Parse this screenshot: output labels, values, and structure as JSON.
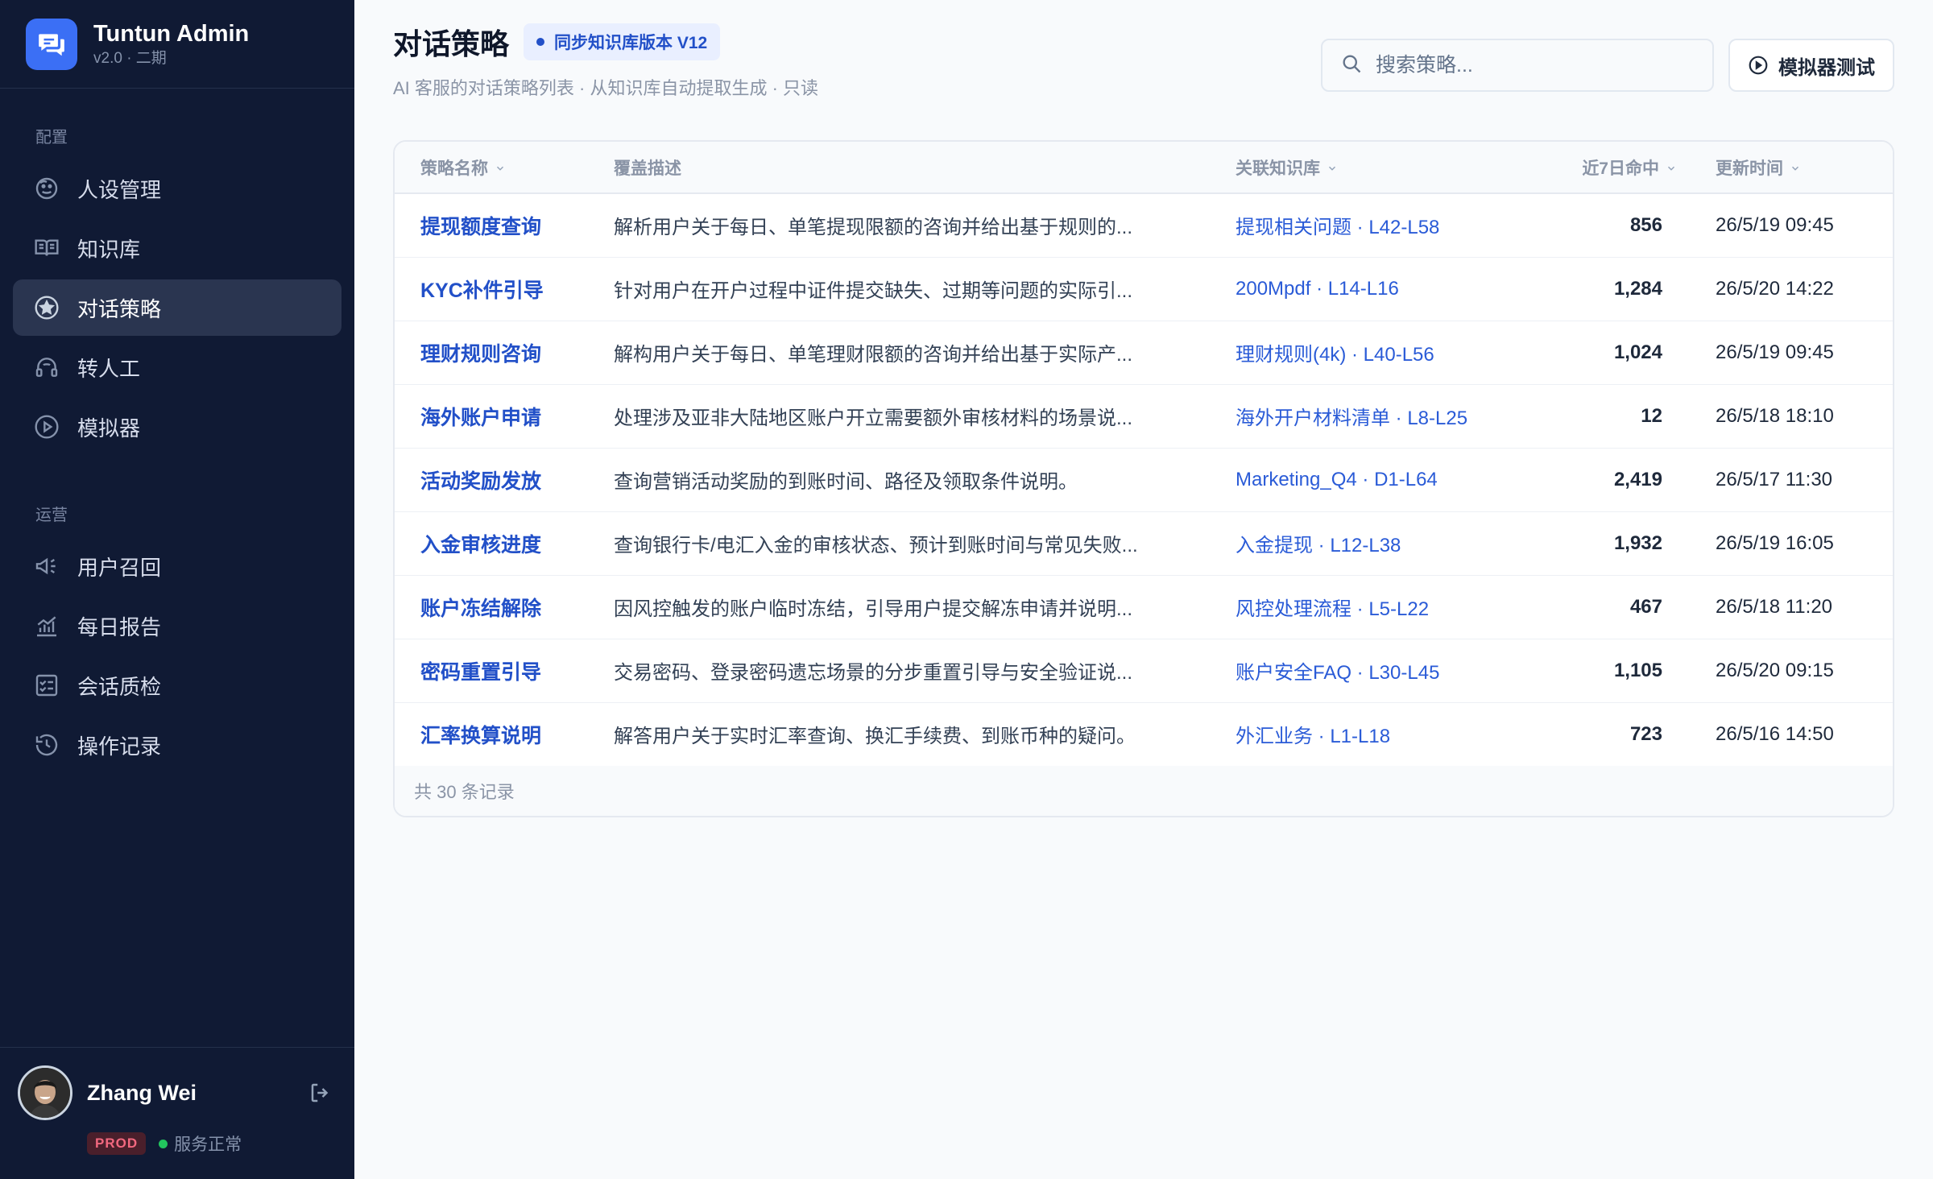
{
  "brand": {
    "name": "Tuntun Admin",
    "version": "v2.0 · 二期"
  },
  "sidebar": {
    "sections": [
      {
        "label": "配置",
        "items": [
          {
            "label": "人设管理",
            "icon": "persona-icon"
          },
          {
            "label": "知识库",
            "icon": "book-icon"
          },
          {
            "label": "对话策略",
            "icon": "star-icon",
            "active": true
          },
          {
            "label": "转人工",
            "icon": "headset-icon"
          },
          {
            "label": "模拟器",
            "icon": "play-icon"
          }
        ]
      },
      {
        "label": "运营",
        "items": [
          {
            "label": "用户召回",
            "icon": "megaphone-icon"
          },
          {
            "label": "每日报告",
            "icon": "chart-icon"
          },
          {
            "label": "会话质检",
            "icon": "checklist-icon"
          },
          {
            "label": "操作记录",
            "icon": "history-icon"
          }
        ]
      }
    ]
  },
  "user": {
    "name": "Zhang Wei",
    "env": "PROD",
    "status": "服务正常"
  },
  "header": {
    "title": "对话策略",
    "badge": "同步知识库版本 V12",
    "subtitle": "AI 客服的对话策略列表 · 从知识库自动提取生成 · 只读",
    "search_placeholder": "搜索策略...",
    "sim_button": "模拟器测试"
  },
  "table": {
    "columns": [
      "策略名称",
      "覆盖描述",
      "关联知识库",
      "近7日命中",
      "更新时间"
    ],
    "rows": [
      {
        "name": "提现额度查询",
        "desc": "解析用户关于每日、单笔提现限额的咨询并给出基于规则的...",
        "kb": "提现相关问题 · L42-L58",
        "hits": "856",
        "time": "26/5/19 09:45"
      },
      {
        "name": "KYC补件引导",
        "desc": "针对用户在开户过程中证件提交缺失、过期等问题的实际引...",
        "kb": "200Mpdf · L14-L16",
        "hits": "1,284",
        "time": "26/5/20 14:22"
      },
      {
        "name": "理财规则咨询",
        "desc": "解构用户关于每日、单笔理财限额的咨询并给出基于实际产...",
        "kb": "理财规则(4k) · L40-L56",
        "hits": "1,024",
        "time": "26/5/19 09:45"
      },
      {
        "name": "海外账户申请",
        "desc": "处理涉及亚非大陆地区账户开立需要额外审核材料的场景说...",
        "kb": "海外开户材料清单 · L8-L25",
        "hits": "12",
        "time": "26/5/18 18:10"
      },
      {
        "name": "活动奖励发放",
        "desc": "查询营销活动奖励的到账时间、路径及领取条件说明。",
        "kb": "Marketing_Q4 · D1-L64",
        "hits": "2,419",
        "time": "26/5/17 11:30"
      },
      {
        "name": "入金审核进度",
        "desc": "查询银行卡/电汇入金的审核状态、预计到账时间与常见失败...",
        "kb": "入金提现 · L12-L38",
        "hits": "1,932",
        "time": "26/5/19 16:05"
      },
      {
        "name": "账户冻结解除",
        "desc": "因风控触发的账户临时冻结，引导用户提交解冻申请并说明...",
        "kb": "风控处理流程 · L5-L22",
        "hits": "467",
        "time": "26/5/18 11:20"
      },
      {
        "name": "密码重置引导",
        "desc": "交易密码、登录密码遗忘场景的分步重置引导与安全验证说...",
        "kb": "账户安全FAQ · L30-L45",
        "hits": "1,105",
        "time": "26/5/20 09:15"
      },
      {
        "name": "汇率换算说明",
        "desc": "解答用户关于实时汇率查询、换汇手续费、到账币种的疑问。",
        "kb": "外汇业务 · L1-L18",
        "hits": "723",
        "time": "26/5/16 14:50"
      }
    ],
    "footer": "共 30 条记录"
  },
  "colors": {
    "sidebar_bg": "#101a34",
    "accent": "#2250c8",
    "active_bg": "#2a3550",
    "status_ok": "#22c55e",
    "env_badge": "#f2687f"
  }
}
